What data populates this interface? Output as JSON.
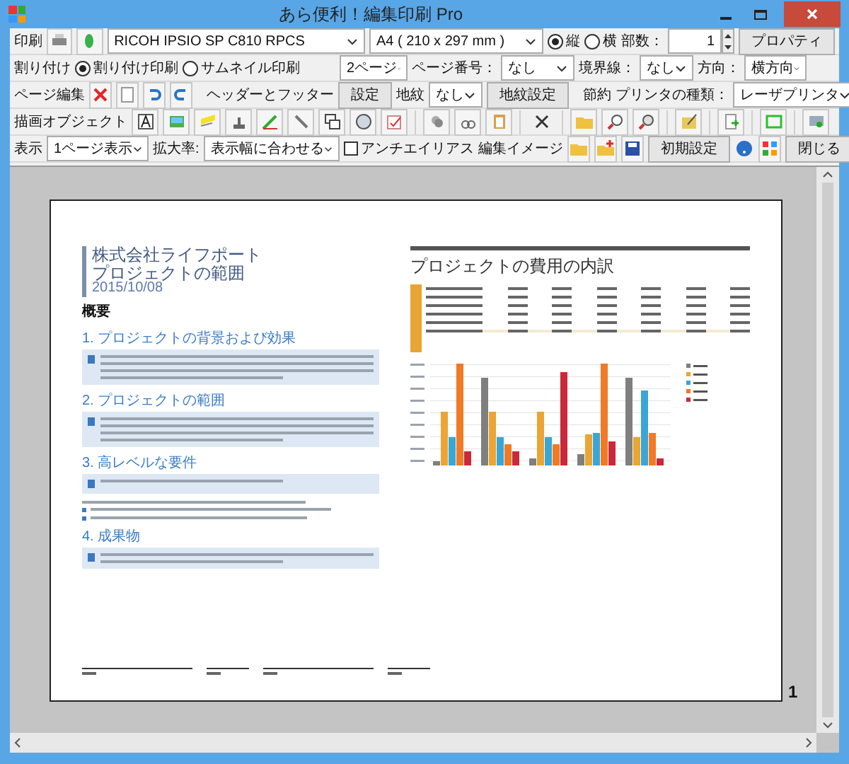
{
  "window": {
    "title": "あら便利！編集印刷 Pro"
  },
  "print_row": {
    "label": "印刷",
    "printer": "RICOH IPSIO SP C810 RPCS",
    "paper": "A4 ( 210 x 297 mm )",
    "orientation": [
      {
        "label": "縦",
        "selected": true
      },
      {
        "label": "横",
        "selected": false
      }
    ],
    "copies_label": "部数：",
    "copies": "1",
    "properties_button": "プロパティ"
  },
  "layout_row": {
    "label": "割り付け",
    "modes": [
      {
        "label": "割り付け印刷",
        "selected": true
      },
      {
        "label": "サムネイル印刷",
        "selected": false
      }
    ],
    "pages": "2ページ",
    "page_number_label": "ページ番号：",
    "page_number": "なし",
    "border_label": "境界線：",
    "border": "なし",
    "direction_label": "方向：",
    "direction": "横方向"
  },
  "edit_row": {
    "label": "ページ編集",
    "header_footer_label": "ヘッダーとフッター",
    "settings_button": "設定",
    "watermark_label": "地紋",
    "watermark": "なし",
    "watermark_button": "地紋設定",
    "save_label": "節約",
    "printer_type_label": "プリンタの種類：",
    "printer_type": "レーザプリンタ"
  },
  "draw_row": {
    "label": "描画オブジェクト"
  },
  "view_row": {
    "label": "表示",
    "view": "1ページ表示",
    "zoom_label": "拡大率:",
    "zoom": "表示幅に合わせる",
    "antialias": {
      "label": "アンチエイリアス",
      "checked": false
    },
    "edit_image_label": "編集イメージ",
    "reset_button": "初期設定",
    "close_button": "閉じる"
  },
  "document": {
    "company": "株式会社ライフポート",
    "title": "プロジェクトの範囲",
    "date": "2015/10/08",
    "overview": "概要",
    "sections": [
      {
        "heading": "1. プロジェクトの背景および効果"
      },
      {
        "heading": "2. プロジェクトの範囲"
      },
      {
        "heading": "3. 高レベルな要件"
      },
      {
        "heading": "4. 成果物"
      }
    ],
    "chart_title": "プロジェクトの費用の内訳",
    "page_number": "1"
  }
}
